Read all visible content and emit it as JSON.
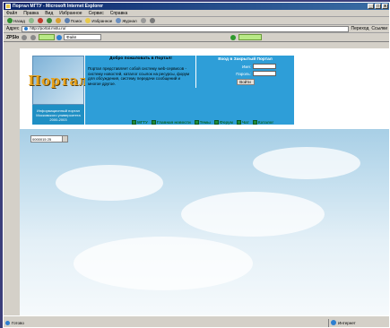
{
  "window": {
    "title": "Портал МГТУ - Microsoft Internet Explorer",
    "buttons": [
      "_",
      "□",
      "x"
    ]
  },
  "menu": [
    "Файл",
    "Правка",
    "Вид",
    "Избранное",
    "Сервис",
    "Справка"
  ],
  "toolbar": {
    "back": "Назад",
    "search": "Поиск",
    "favorites": "Избранное",
    "media": "Журнал"
  },
  "address": {
    "label": "Адрес",
    "value": "http://portal.mstu.ru/",
    "go": "Переход",
    "links": "Ссылки"
  },
  "linksbar": {
    "label": "ZPSlo",
    "select_value": "Файл",
    "green": ""
  },
  "page": {
    "logo_text": "Портал",
    "logo_caption": "Информационный портал Московского университета 2000-2003",
    "welcome_title": "Добро пожаловать в Портал!",
    "welcome_text": "Портал представляет собой систему web-сервисов - систему новостей, каталог ссылок на ресурсы, форум для обсуждения, систему передачи сообщений и многое другое.",
    "login_title": "Вход в Закрытый Портал",
    "login_label": "Имя:",
    "password_label": "Пароль:",
    "login_button": "Войти",
    "nav": [
      "МГТУ",
      "Главная новости",
      "Темы",
      "Форум",
      "Чат",
      "Каталог"
    ],
    "counter_value": "0000015 25"
  },
  "status": {
    "left": "Готово",
    "right": "Интернет"
  },
  "colors": {
    "panel": "#2e9ed8",
    "nav": "#0b6b32",
    "logo_text": "#e8a21c"
  }
}
